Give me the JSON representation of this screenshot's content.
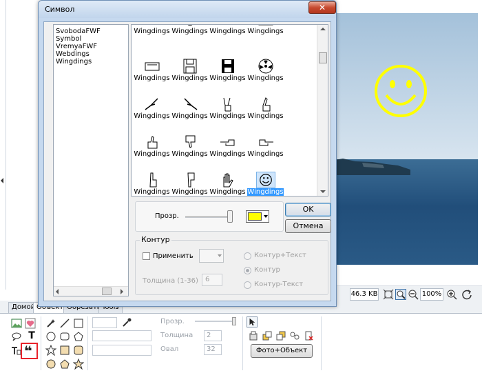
{
  "dialog": {
    "title": "Символ",
    "close_glyph": "✕",
    "font_list": [
      "SvobodaFWF",
      "Symbol",
      "VremyaFWF",
      "Webdings",
      "Wingdings"
    ],
    "symbol_label": "Wingdings",
    "rows": [
      [
        "keyboard-icon",
        "mouse-icon",
        "trackball-icon",
        "desktop-icon"
      ],
      [
        "floppy-outline-icon",
        "floppy-icon",
        "floppy-dark-icon",
        "radioactive-icon"
      ],
      [
        "writing-hand-icon",
        "writing-hand-left-icon",
        "victory-hand-icon",
        "crossed-fingers-icon"
      ],
      [
        "thumbs-up-icon",
        "thumbs-down-icon",
        "point-left-icon",
        "point-right-icon"
      ],
      [
        "point-up-icon",
        "point-down-icon",
        "open-hand-icon",
        "smiley-icon"
      ]
    ],
    "selected_symbol": "smiley-icon",
    "transparency_label": "Прозр.",
    "color_value": "#ffff00",
    "ok_label": "OK",
    "cancel_label": "Отмена",
    "contour": {
      "legend": "Контур",
      "apply_label": "Применить",
      "thickness_label": "Толщина (1-36)",
      "thickness_value": "6",
      "options": [
        "Контур+Текст",
        "Контур",
        "Контур-Текст"
      ],
      "selected_option": "Контур"
    }
  },
  "photo": {
    "overlay_symbol": "smiley-icon",
    "overlay_color": "#ffff00"
  },
  "status_bar": {
    "file_size": "46.3 KB",
    "zoom": "100%"
  },
  "ribbon": {
    "tabs": [
      "Домой",
      "Объект",
      "Обрезать",
      "Tools"
    ],
    "active_tab": "Объект",
    "transparency_label": "Прозр.",
    "thickness_label": "Толщина",
    "thickness_value": "2",
    "oval_label": "Овал",
    "oval_value": "32",
    "photo_object_label": "Фото+Объект"
  },
  "colors": {
    "accent": "#3399ff",
    "dialog_frame": "#c6d9ef",
    "highlight_frame": "#e8232b"
  }
}
